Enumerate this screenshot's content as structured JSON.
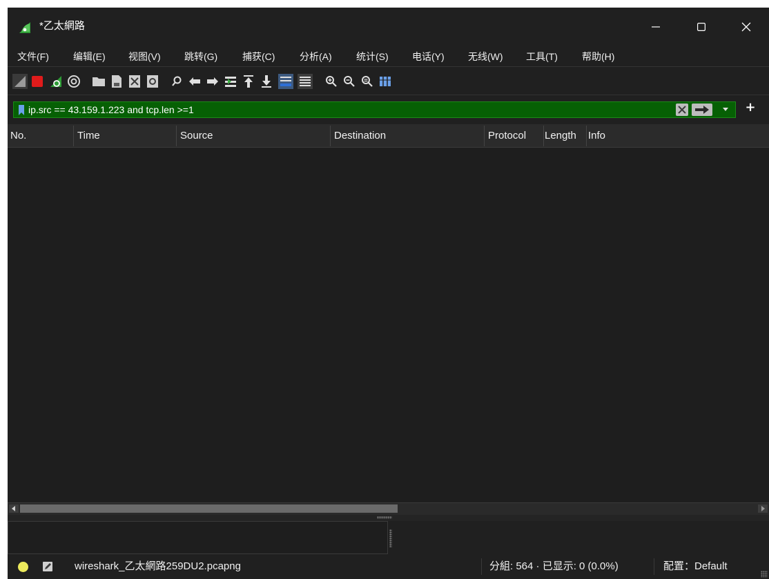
{
  "window": {
    "title": "*乙太網路",
    "controls": {
      "minimize": "minimize-icon",
      "maximize": "maximize-icon",
      "close": "close-icon"
    }
  },
  "menu": {
    "items": [
      {
        "label": "文件(F)"
      },
      {
        "label": "编辑(E)"
      },
      {
        "label": "视图(V)"
      },
      {
        "label": "跳转(G)"
      },
      {
        "label": "捕获(C)"
      },
      {
        "label": "分析(A)"
      },
      {
        "label": "统计(S)"
      },
      {
        "label": "电话(Y)"
      },
      {
        "label": "无线(W)"
      },
      {
        "label": "工具(T)"
      },
      {
        "label": "帮助(H)"
      }
    ]
  },
  "toolbar": {
    "icons": [
      "start-capture-icon",
      "stop-capture-icon",
      "restart-capture-icon",
      "capture-options-icon",
      "open-file-icon",
      "save-file-icon",
      "close-file-icon",
      "reload-file-icon",
      "find-packet-icon",
      "go-back-icon",
      "go-forward-icon",
      "go-to-packet-icon",
      "first-packet-icon",
      "last-packet-icon",
      "auto-scroll-icon",
      "colorize-icon",
      "zoom-in-icon",
      "zoom-out-icon",
      "normal-size-icon",
      "resize-columns-icon"
    ]
  },
  "filter": {
    "value": "ip.src == 43.159.1.223 and tcp.len >=1",
    "valid_color": "#066004"
  },
  "packet_list": {
    "columns": [
      {
        "label": "No."
      },
      {
        "label": "Time"
      },
      {
        "label": "Source"
      },
      {
        "label": "Destination"
      },
      {
        "label": "Protocol"
      },
      {
        "label": "Length"
      },
      {
        "label": "Info"
      }
    ],
    "rows": []
  },
  "statusbar": {
    "file": "wireshark_乙太網路259DU2.pcapng",
    "stats": "分組: 564 · 已显示: 0 (0.0%)",
    "profile": "配置：Default",
    "capture_status_color": "#ecea5c"
  }
}
